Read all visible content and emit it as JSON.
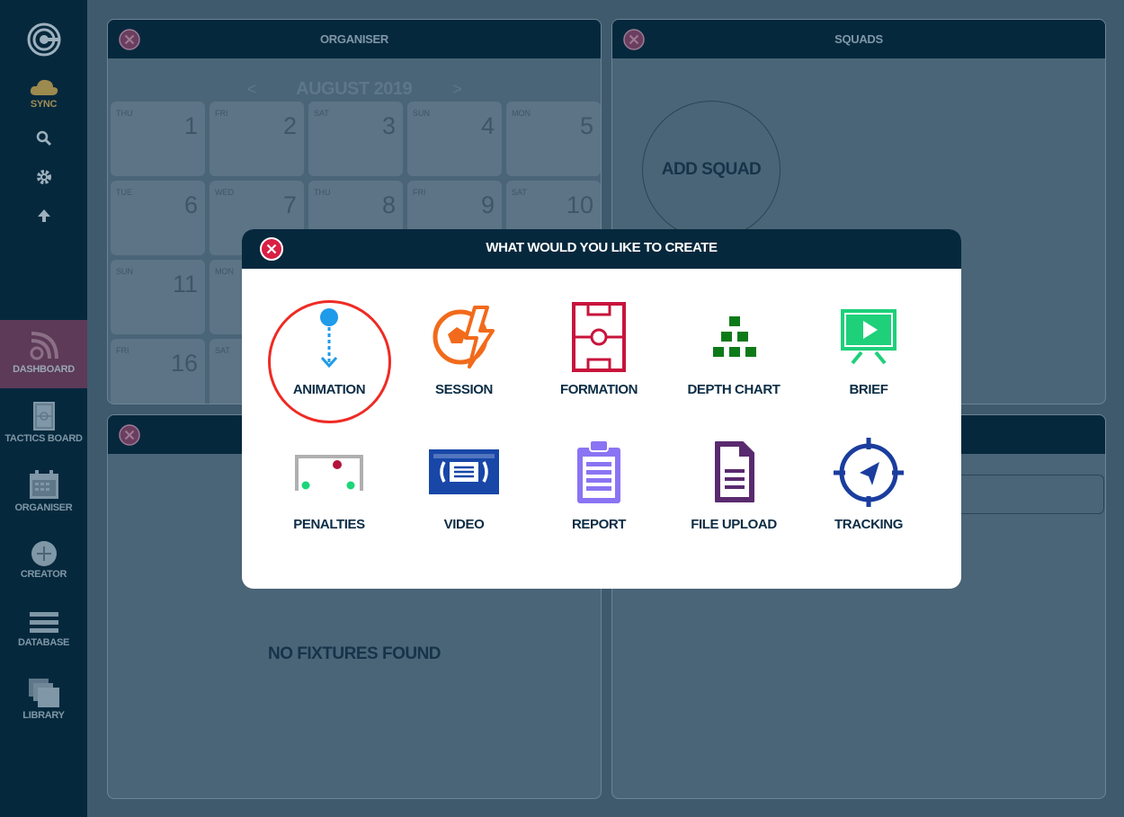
{
  "sidebar": {
    "sync_label": "SYNC",
    "items": [
      {
        "label": "DASHBOARD",
        "icon": "dashboard-icon"
      },
      {
        "label": "TACTICS BOARD",
        "icon": "tactics-board-icon"
      },
      {
        "label": "ORGANISER",
        "icon": "calendar-icon"
      },
      {
        "label": "CREATOR",
        "icon": "plus-circle-icon"
      },
      {
        "label": "DATABASE",
        "icon": "list-icon"
      },
      {
        "label": "LIBRARY",
        "icon": "folders-icon"
      }
    ]
  },
  "organiser": {
    "title": "ORGANISER",
    "month": "AUGUST 2019",
    "prev": "<",
    "next": ">",
    "days": [
      {
        "dow": "THU",
        "date": "1"
      },
      {
        "dow": "FRI",
        "date": "2"
      },
      {
        "dow": "SAT",
        "date": "3"
      },
      {
        "dow": "SUN",
        "date": "4"
      },
      {
        "dow": "MON",
        "date": "5"
      },
      {
        "dow": "TUE",
        "date": "6"
      },
      {
        "dow": "WED",
        "date": "7"
      },
      {
        "dow": "THU",
        "date": "8"
      },
      {
        "dow": "FRI",
        "date": "9"
      },
      {
        "dow": "SAT",
        "date": "10"
      },
      {
        "dow": "SUN",
        "date": "11"
      },
      {
        "dow": "MON",
        "date": ""
      },
      {
        "dow": "FRI",
        "date": "16"
      },
      {
        "dow": "SAT",
        "date": ""
      }
    ]
  },
  "squads": {
    "title": "SQUADS",
    "add_label": "ADD SQUAD"
  },
  "fixtures": {
    "empty_text": "NO FIXTURES FOUND"
  },
  "modal": {
    "title": "WHAT WOULD YOU LIKE TO CREATE",
    "options": [
      {
        "label": "ANIMATION",
        "icon": "animation-icon",
        "color": "#1e9be9",
        "highlighted": true
      },
      {
        "label": "SESSION",
        "icon": "session-icon",
        "color": "#f26a1b"
      },
      {
        "label": "FORMATION",
        "icon": "formation-icon",
        "color": "#c8143c"
      },
      {
        "label": "DEPTH CHART",
        "icon": "depth-chart-icon",
        "color": "#0d7a1a"
      },
      {
        "label": "BRIEF",
        "icon": "brief-icon",
        "color": "#1ed07a"
      },
      {
        "label": "PENALTIES",
        "icon": "penalties-icon",
        "color": "#a9a9a9"
      },
      {
        "label": "VIDEO",
        "icon": "video-icon",
        "color": "#1847a8"
      },
      {
        "label": "REPORT",
        "icon": "report-icon",
        "color": "#8a74f3"
      },
      {
        "label": "FILE UPLOAD",
        "icon": "file-upload-icon",
        "color": "#5a2a6e"
      },
      {
        "label": "TRACKING",
        "icon": "tracking-icon",
        "color": "#1a3d9e"
      }
    ]
  }
}
